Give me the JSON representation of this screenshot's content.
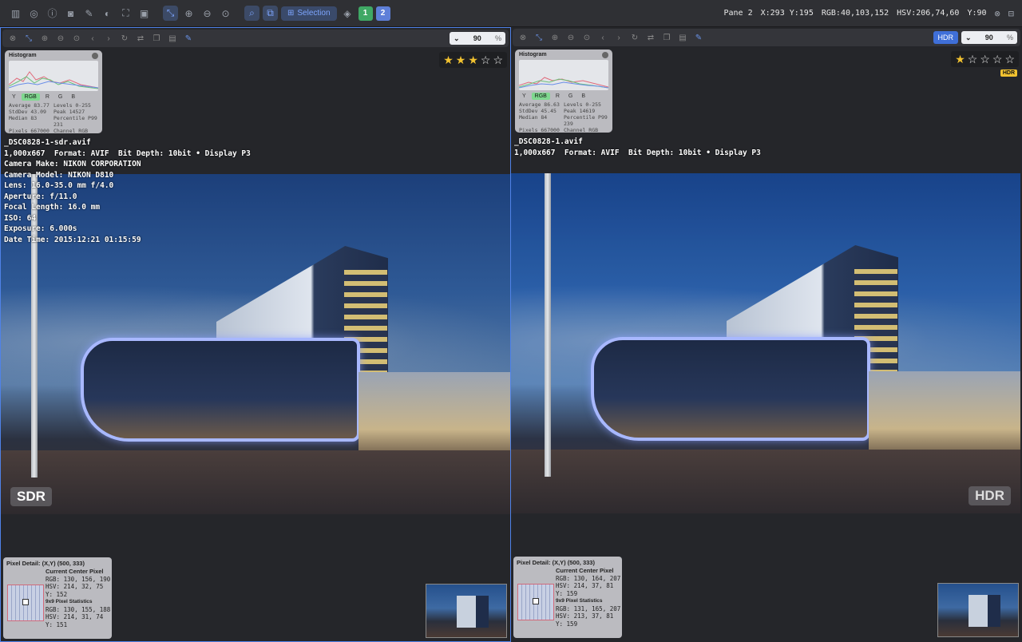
{
  "topbar": {
    "selection_label": "Selection",
    "pane_one": "1",
    "pane_two": "2",
    "status": {
      "pane": "Pane 2",
      "xy": "X:293 Y:195",
      "rgb": "RGB:40,103,152",
      "hsv": "HSV:206,74,60",
      "y": "Y:90"
    }
  },
  "left": {
    "zoom": "90",
    "zoom_unit": "%",
    "tag": "SDR",
    "stars": [
      "★",
      "★",
      "★",
      "☆",
      "☆"
    ],
    "histogram": {
      "title": "Histogram",
      "tabs": [
        "Y",
        "RGB",
        "R",
        "G",
        "B"
      ],
      "stats": [
        "Average 83.77",
        "Levels 0-255",
        "StdDev 43.09",
        "Peak 14527",
        "Median 83",
        "Percentile P99 231",
        "Pixels 667000",
        "Channel RGB"
      ]
    },
    "meta": [
      "_DSC0828-1-sdr.avif",
      "1,000x667  Format: AVIF  Bit Depth: 10bit • Display P3",
      "Camera Make: NIKON CORPORATION",
      "Camera Model: NIKON D810",
      "Lens: 16.0-35.0 mm f/4.0",
      "Aperture: f/11.0",
      "Focal Length: 16.0 mm",
      "ISO: 64",
      "Exposure: 6.000s",
      "Date Time: 2015:12:21 01:15:59"
    ],
    "pixel": {
      "head": "Pixel Detail: (X,Y) (500, 333)",
      "center_title": "Current Center Pixel",
      "center": [
        "RGB: 130, 156, 190",
        "HSV: 214, 32, 75",
        "Y: 152"
      ],
      "stats_title": "9x9 Pixel Statistics",
      "stats": [
        "RGB: 130, 155, 188",
        "HSV: 214, 31, 74",
        "Y: 151"
      ]
    }
  },
  "right": {
    "zoom": "90",
    "zoom_unit": "%",
    "hdr_button": "HDR",
    "hdr_badge": "HDR",
    "tag": "HDR",
    "stars": [
      "★",
      "☆",
      "☆",
      "☆",
      "☆"
    ],
    "histogram": {
      "title": "Histogram",
      "tabs": [
        "Y",
        "RGB",
        "R",
        "G",
        "B"
      ],
      "stats": [
        "Average 86.63",
        "Levels 0-255",
        "StdDev 45.45",
        "Peak 14619",
        "Median 84",
        "Percentile P99 239",
        "Pixels 667000",
        "Channel RGB"
      ]
    },
    "meta": [
      "_DSC0828-1.avif",
      "1,000x667  Format: AVIF  Bit Depth: 10bit • Display P3"
    ],
    "pixel": {
      "head": "Pixel Detail: (X,Y) (500, 333)",
      "center_title": "Current Center Pixel",
      "center": [
        "RGB: 130, 164, 207",
        "HSV: 214, 37, 81",
        "Y: 159"
      ],
      "stats_title": "9x9 Pixel Statistics",
      "stats": [
        "RGB: 131, 165, 207",
        "HSV: 213, 37, 81",
        "Y: 159"
      ]
    }
  },
  "colors": {
    "accent": "#4f82e8",
    "star": "#f2c230",
    "badge_green": "#3fa865"
  }
}
